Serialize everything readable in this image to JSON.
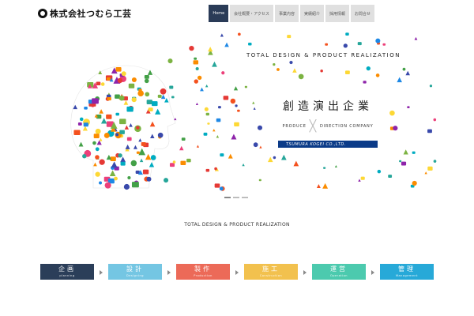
{
  "logo": {
    "text": "株式会社つむら工芸"
  },
  "nav": [
    {
      "label": "Home",
      "active": true
    },
    {
      "label": "会社概要・アクセス",
      "active": false
    },
    {
      "label": "事業内容",
      "active": false
    },
    {
      "label": "実績紹介",
      "active": false
    },
    {
      "label": "採用情報",
      "active": false
    },
    {
      "label": "お問合せ",
      "active": false
    }
  ],
  "hero": {
    "tagline": "TOTAL DESIGN & PRODUCT REALIZATION",
    "kanji": "創造演出企業",
    "produce": "PRODUCE",
    "direction": "DIRECTION COMPANY",
    "company": "TSUMURA KOGEI CO.,LTD.",
    "icon_colors": [
      "#e53935",
      "#fb8c00",
      "#fdd835",
      "#43a047",
      "#1e88e5",
      "#8e24aa",
      "#00acc1",
      "#ec407a",
      "#7cb342",
      "#3949ab",
      "#f4511e",
      "#26a69a"
    ]
  },
  "slider": {
    "count": 3,
    "active": 0
  },
  "subtitle": "TOTAL DESIGN & PRODUCT REALIZATION",
  "steps": [
    {
      "title": "企画",
      "sub": "planning",
      "color": "#2b3e59"
    },
    {
      "title": "設計",
      "sub": "Designing",
      "color": "#74c6e3"
    },
    {
      "title": "製作",
      "sub": "Production",
      "color": "#ec6a58"
    },
    {
      "title": "施工",
      "sub": "Construction",
      "color": "#f2c14e"
    },
    {
      "title": "運営",
      "sub": "Operation",
      "color": "#4ccaae"
    },
    {
      "title": "管理",
      "sub": "Management",
      "color": "#27a9d8"
    }
  ]
}
